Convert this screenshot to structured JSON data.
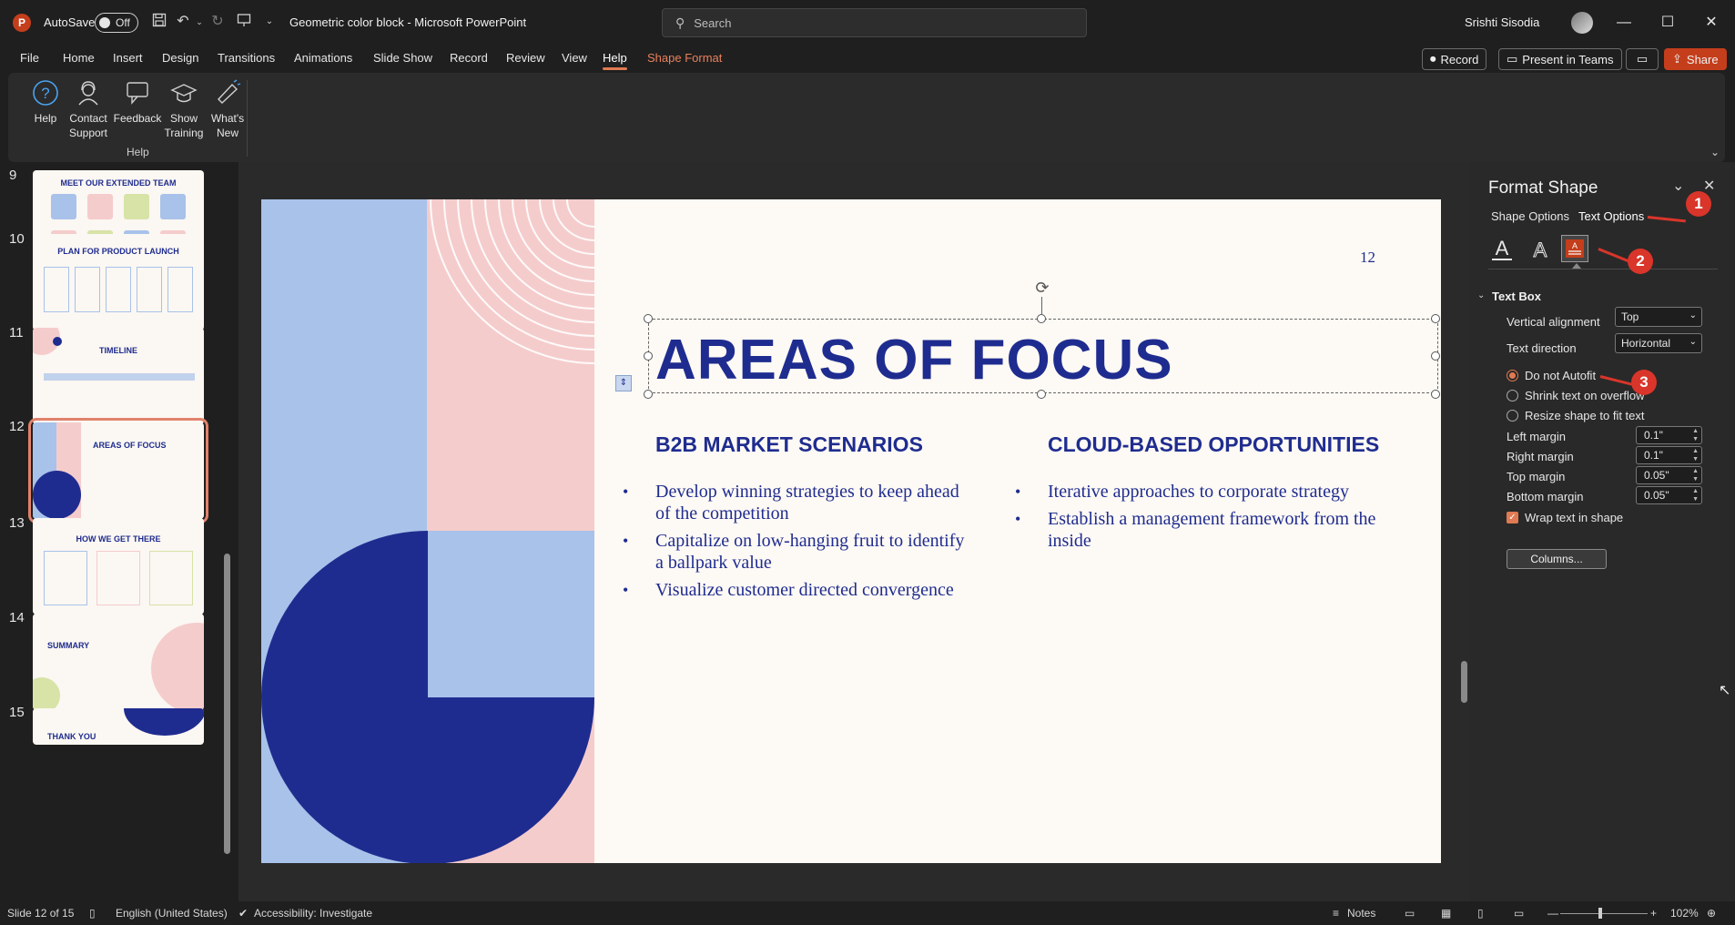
{
  "window": {
    "app_letter": "P",
    "autosave_label": "AutoSave",
    "autosave_state": "Off",
    "doc_title": "Geometric color block  -  Microsoft PowerPoint",
    "search_placeholder": "Search",
    "user_name": "Srishti Sisodia"
  },
  "menu": {
    "items": [
      "File",
      "Home",
      "Insert",
      "Design",
      "Transitions",
      "Animations",
      "Slide Show",
      "Record",
      "Review",
      "View",
      "Help",
      "Shape Format"
    ],
    "active": "Help",
    "record_btn": "Record",
    "present_btn": "Present in Teams",
    "share_btn": "Share"
  },
  "ribbon": {
    "buttons": [
      {
        "line1": "Help",
        "line2": ""
      },
      {
        "line1": "Contact",
        "line2": "Support"
      },
      {
        "line1": "Feedback",
        "line2": ""
      },
      {
        "line1": "Show",
        "line2": "Training"
      },
      {
        "line1": "What's",
        "line2": "New"
      }
    ],
    "group_label": "Help"
  },
  "thumbnails": [
    {
      "num": "9",
      "title": "MEET OUR EXTENDED TEAM"
    },
    {
      "num": "10",
      "title": "PLAN FOR PRODUCT LAUNCH"
    },
    {
      "num": "11",
      "title": "TIMELINE"
    },
    {
      "num": "12",
      "title": "AREAS OF FOCUS"
    },
    {
      "num": "13",
      "title": "HOW WE GET THERE"
    },
    {
      "num": "14",
      "title": "SUMMARY"
    },
    {
      "num": "15",
      "title": "THANK YOU"
    }
  ],
  "slide": {
    "number": "12",
    "title": "AREAS OF FOCUS",
    "left_heading": "B2B MARKET SCENARIOS",
    "left_bullets": [
      "Develop winning strategies to keep ahead of the competition",
      "Capitalize on low-hanging fruit to identify a ballpark value",
      "Visualize customer directed convergence"
    ],
    "right_heading": "CLOUD-BASED OPPORTUNITIES",
    "right_bullets": [
      "Iterative approaches to corporate strategy",
      "Establish a management framework from the inside"
    ]
  },
  "format_pane": {
    "title": "Format Shape",
    "tab_shape": "Shape Options",
    "tab_text": "Text Options",
    "section": "Text Box",
    "vertical_alignment_label": "Vertical alignment",
    "vertical_alignment_value": "Top",
    "text_direction_label": "Text direction",
    "text_direction_value": "Horizontal",
    "autofit_options": [
      "Do not Autofit",
      "Shrink text on overflow",
      "Resize shape to fit text"
    ],
    "left_margin_label": "Left margin",
    "left_margin_value": "0.1\"",
    "right_margin_label": "Right margin",
    "right_margin_value": "0.1\"",
    "top_margin_label": "Top margin",
    "top_margin_value": "0.05\"",
    "bottom_margin_label": "Bottom margin",
    "bottom_margin_value": "0.05\"",
    "wrap_label": "Wrap text in shape",
    "columns_btn": "Columns..."
  },
  "callouts": [
    "1",
    "2",
    "3"
  ],
  "status": {
    "slide_info": "Slide 12 of 15",
    "language": "English (United States)",
    "accessibility": "Accessibility: Investigate",
    "notes": "Notes",
    "zoom": "102%"
  },
  "colors": {
    "accent": "#e07a52",
    "slide_navy": "#1f2c8f",
    "slide_blue": "#a8c2ea",
    "slide_pink": "#f5cccc",
    "callout_red": "#d9352a"
  }
}
